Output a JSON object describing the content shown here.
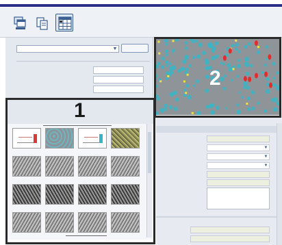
{
  "callouts": {
    "gallery_number": "1",
    "image_number": "2"
  },
  "toolbar": {
    "buttons": [
      {
        "name": "layout-view-1",
        "icon": "window-stack-icon"
      },
      {
        "name": "layout-view-2",
        "icon": "document-copy-icon"
      },
      {
        "name": "layout-view-3",
        "icon": "grid-table-icon",
        "active": true
      }
    ]
  },
  "colors": {
    "title_stripe": "#2b2f86",
    "frame": "#2a2a2a",
    "image_bg": "#8f9499",
    "cell": "#37b6c8",
    "marker_yellow": "#f1e33b",
    "marker_red": "#e32d2d"
  },
  "gallery": {
    "rows": 4,
    "cols": 4,
    "thumbnails": [
      "chart-thumbnail",
      "red-cells-thumbnail",
      "chart-thumbnail",
      "yellow-texture-thumbnail",
      "gray-texture-thumbnail",
      "gray-texture-thumbnail",
      "gray-texture-thumbnail",
      "gray-texture-thumbnail",
      "gray-texture-thumbnail",
      "gray-texture-thumbnail",
      "gray-texture-thumbnail",
      "gray-texture-thumbnail",
      "gray-texture-thumbnail",
      "gray-texture-thumbnail",
      "gray-texture-thumbnail",
      "gray-texture-thumbnail"
    ]
  }
}
